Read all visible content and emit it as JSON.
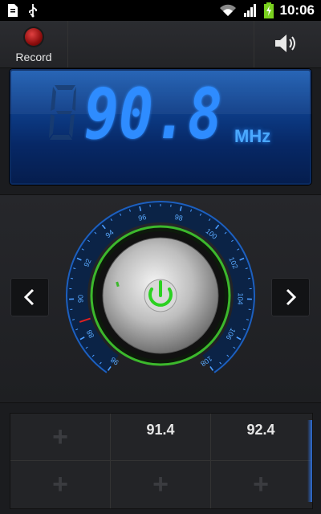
{
  "status": {
    "time": "10:06",
    "icons": [
      "document-icon",
      "usb-icon",
      "wifi-icon",
      "signal-icon",
      "battery-charging-icon"
    ]
  },
  "toolbar": {
    "record_label": "Record",
    "speaker_icon": "speaker-icon"
  },
  "tuner": {
    "frequency": "90.8",
    "unit": "MHz",
    "dial_labels": [
      "98",
      "88",
      "90",
      "92",
      "94",
      "96",
      "98",
      "100",
      "102",
      "104",
      "106",
      "108"
    ]
  },
  "nav": {
    "prev_icon": "chevron-left-icon",
    "next_icon": "chevron-right-icon"
  },
  "presets": [
    {
      "label": "",
      "empty": true
    },
    {
      "label": "91.4",
      "empty": false
    },
    {
      "label": "92.4",
      "empty": false
    },
    {
      "label": "",
      "empty": true
    },
    {
      "label": "",
      "empty": true
    },
    {
      "label": "",
      "empty": true
    }
  ],
  "colors": {
    "display_blue": "#1e5fb4",
    "digit_blue": "#2d8cff",
    "ring_green": "#3cb82c",
    "record_red": "#c62020"
  }
}
